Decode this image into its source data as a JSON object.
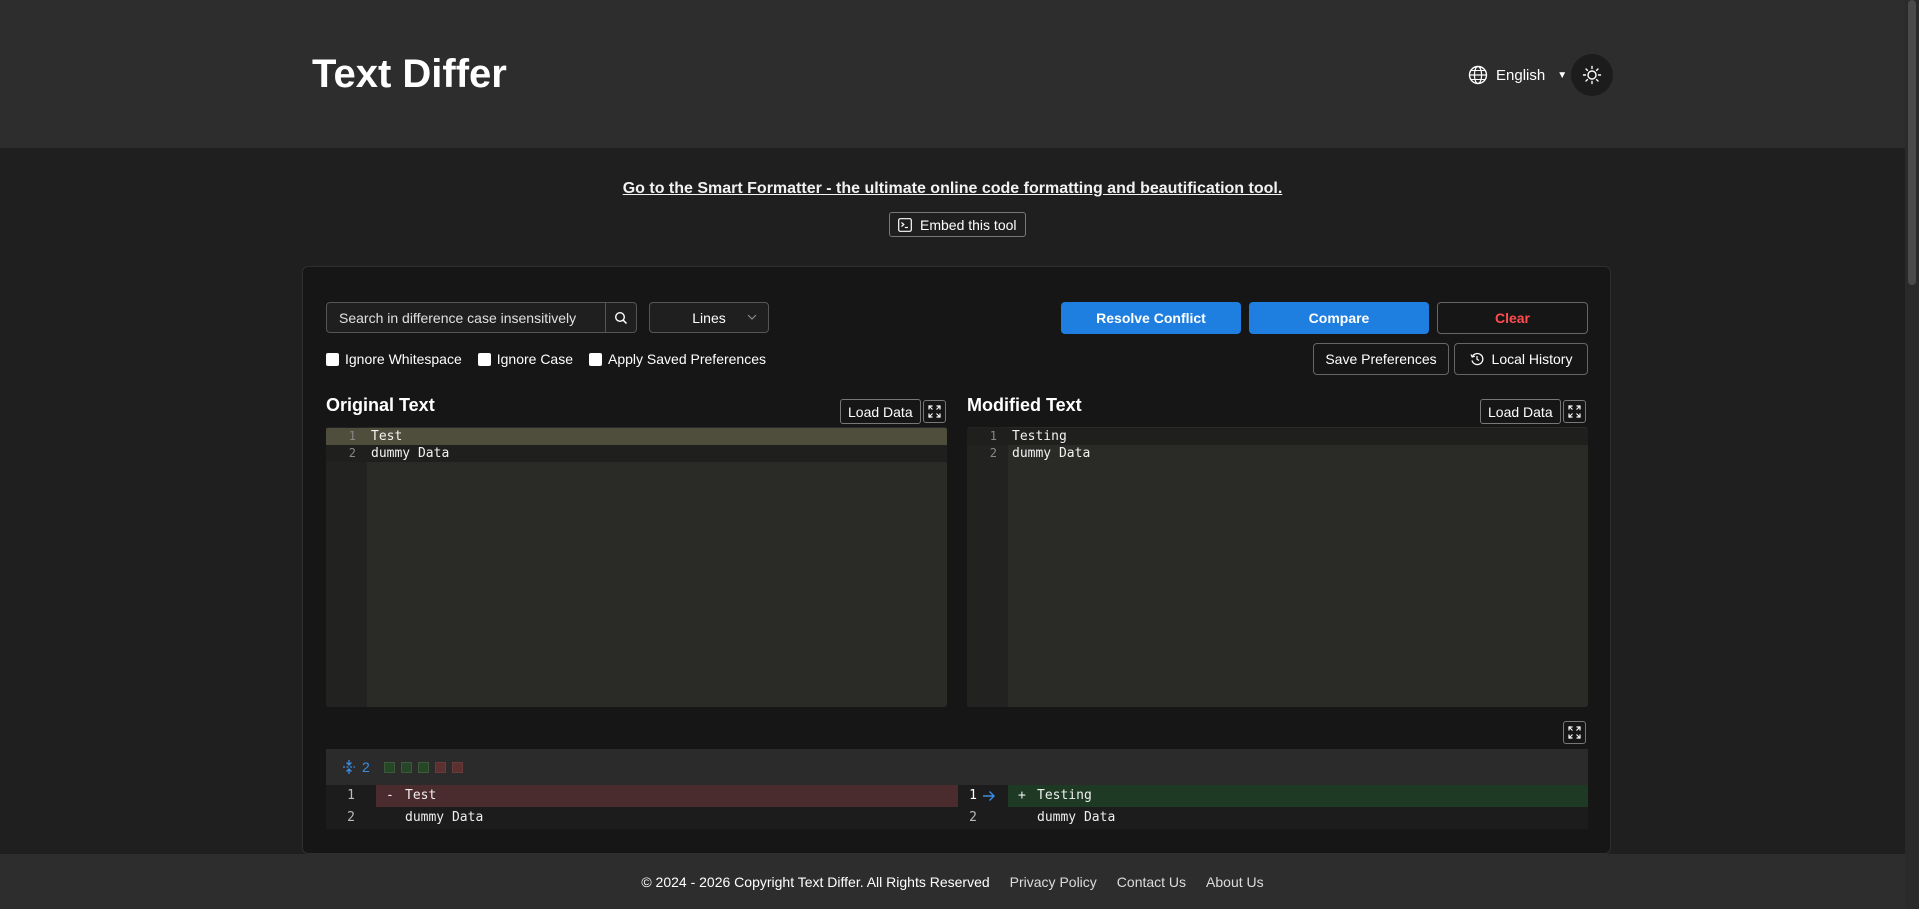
{
  "header": {
    "title": "Text Differ",
    "language": "English"
  },
  "promo": {
    "link_text": "Go to the Smart Formatter - the ultimate online code formatting and beautification tool.",
    "embed_label": "Embed this tool"
  },
  "toolbar": {
    "search_placeholder": "Search in difference case insensitively",
    "mode": "Lines",
    "resolve_label": "Resolve Conflict",
    "compare_label": "Compare",
    "clear_label": "Clear",
    "save_prefs_label": "Save Preferences",
    "history_label": "Local History",
    "checkboxes": [
      {
        "label": "Ignore Whitespace",
        "checked": false
      },
      {
        "label": "Ignore Case",
        "checked": false
      },
      {
        "label": "Apply Saved Preferences",
        "checked": false
      }
    ]
  },
  "original": {
    "title": "Original Text",
    "load_label": "Load Data",
    "lines": [
      {
        "num": "1",
        "text": "Test"
      },
      {
        "num": "2",
        "text": "dummy Data"
      }
    ]
  },
  "modified": {
    "title": "Modified Text",
    "load_label": "Load Data",
    "lines": [
      {
        "num": "1",
        "text": "Testing"
      },
      {
        "num": "2",
        "text": "dummy Data"
      }
    ]
  },
  "diff": {
    "change_count": "2",
    "left": [
      {
        "num": "1",
        "marker": "-",
        "text": "Test"
      },
      {
        "num": "2",
        "marker": "",
        "text": "dummy Data"
      }
    ],
    "right": [
      {
        "num": "1",
        "marker": "+",
        "text": "Testing"
      },
      {
        "num": "2",
        "marker": "",
        "text": "dummy Data"
      }
    ]
  },
  "footer": {
    "copyright": "© 2024 - 2026 Copyright Text Differ. All Rights Reserved",
    "privacy": "Privacy Policy",
    "contact": "Contact Us",
    "about": "About Us"
  },
  "colors": {
    "accent": "#1f7fe0",
    "danger": "#ff4d4f",
    "background": "#1f1f1f"
  }
}
